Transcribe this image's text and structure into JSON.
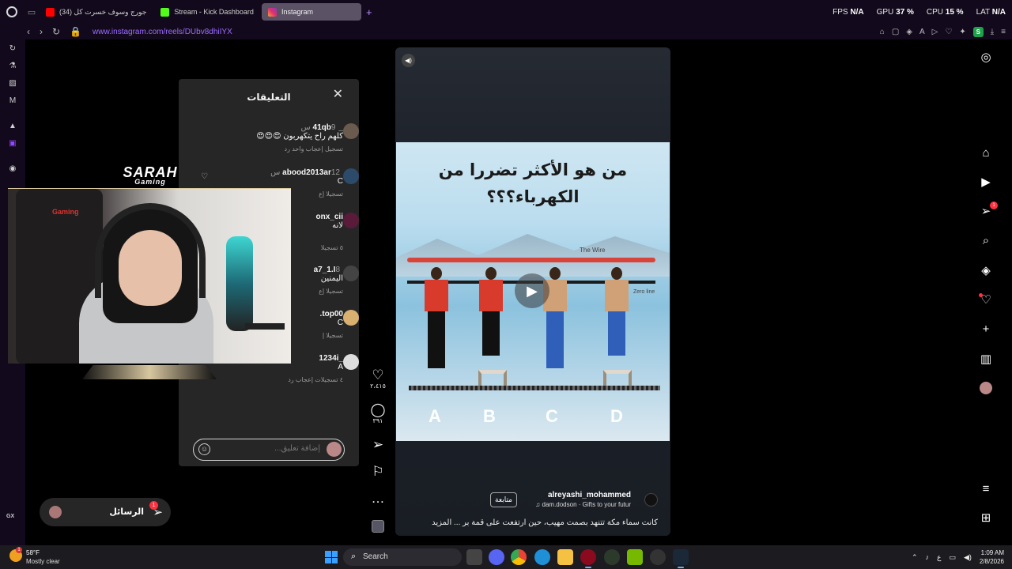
{
  "browser": {
    "tabs": [
      {
        "title": "(34) جورج وسوف خسرت كل",
        "favicon": "youtube",
        "active": false
      },
      {
        "title": "Stream - Kick Dashboard",
        "favicon": "kick",
        "active": false
      },
      {
        "title": "Instagram",
        "favicon": "instagram",
        "active": true
      }
    ],
    "url": "www.instagram.com/reels/DUbv8dhiIYX",
    "hw": {
      "fps_label": "FPS",
      "fps_value": "N/A",
      "gpu_label": "GPU",
      "gpu_value": "37 %",
      "cpu_label": "CPU",
      "cpu_value": "15 %",
      "lat_label": "LAT",
      "lat_value": "N/A"
    },
    "profile_letter": "S",
    "sidebar_label": "GX"
  },
  "comments": {
    "title": "التعليقات",
    "items": [
      {
        "user": "_41qb",
        "ago": "9 س",
        "text": "كلهم راح يتكهربون 😍😍😍",
        "meta": "تسجيل إعجاب واحد   رد"
      },
      {
        "user": "abood2013ar",
        "ago": "12 س",
        "text": "C",
        "meta": "تسجيلا إع"
      },
      {
        "user": "onx_cii",
        "ago": "",
        "text": "لانه",
        "meta": "٥ تسجيلا"
      },
      {
        "user": "a7_1.I",
        "ago": "8",
        "text": "اليمنين",
        "meta": "تسجيلا إع"
      },
      {
        "user": "top00.",
        "ago": "",
        "text": "C",
        "meta": "تسجيلا إ"
      },
      {
        "user": "_1234i",
        "ago": "",
        "text": "A",
        "meta": "٤ تسجيلات إعجاب   رد"
      }
    ],
    "input_placeholder": "إضافة تعليق..."
  },
  "actions": {
    "likes": "٢،٤١٥",
    "comments_count": "٣٩١"
  },
  "reel": {
    "title_line1": "من هو الأكثر تضررا من",
    "title_line2": "الكهرباء؟؟؟",
    "wire_label": "The Wire",
    "zero_label": "Zero line",
    "options": [
      "A",
      "B",
      "C",
      "D"
    ],
    "username": "alreyashi_mohammed",
    "follow": "متابعة",
    "audio": "dam.dodson · Gifts to your futur ♫",
    "caption": "كانت سماء مكة تتنهد بصمت مهيب، حين ارتفعت على قمة بر ... المزيد"
  },
  "messages": {
    "label": "الرسائل",
    "badge": "1"
  },
  "notification_badge": "1",
  "webcam": {
    "brand": "SARAH",
    "brand_sub": "Gaming",
    "chair_label": "Gaming"
  },
  "taskbar": {
    "temp": "58°F",
    "condition": "Mostly clear",
    "weather_badge": "1",
    "search": "Search",
    "lang": "ع",
    "time": "1:09 AM",
    "date": "2/8/2026"
  },
  "colors": {
    "accent": "#9d6cff",
    "like_badge": "#ff3040"
  }
}
